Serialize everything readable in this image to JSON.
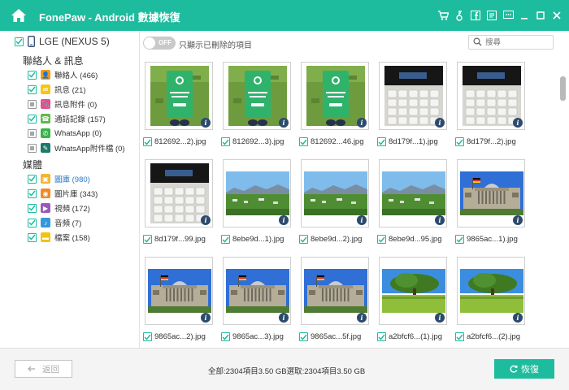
{
  "app": {
    "title": "FonePaw - Android 數據恢復",
    "accent_color": "#1ebc9e",
    "titlebar_icons": [
      "cart-icon",
      "key-icon",
      "facebook-icon",
      "feedback-icon",
      "chat-icon",
      "minimize-icon",
      "maximize-icon",
      "close-icon"
    ]
  },
  "sidebar": {
    "device": "LGE (NEXUS 5)",
    "categories": [
      {
        "title": "聯絡人 & 訊息",
        "items": [
          {
            "label": "聯絡人 (466)",
            "icon": "contacts-icon",
            "color": "#f39a1e",
            "checked": "partial"
          },
          {
            "label": "訊息 (21)",
            "icon": "message-icon",
            "color": "#f5c518",
            "checked": "partial"
          },
          {
            "label": "訊息附件 (0)",
            "icon": "attachment-icon",
            "color": "#e94d8a",
            "checked": "gray"
          },
          {
            "label": "通話記錄 (157)",
            "icon": "call-log-icon",
            "color": "#5fb94b",
            "checked": "partial"
          },
          {
            "label": "WhatsApp (0)",
            "icon": "whatsapp-icon",
            "color": "#3bb34a",
            "checked": "gray"
          },
          {
            "label": "WhatsApp附件檔 (0)",
            "icon": "whatsapp-attachment-icon",
            "color": "#1d7a6b",
            "checked": "gray"
          }
        ]
      },
      {
        "title": "媒體",
        "items": [
          {
            "label": "圖庫 (980)",
            "icon": "gallery-icon",
            "color": "#f2b531",
            "checked": "checked",
            "active": true
          },
          {
            "label": "圖片庫 (343)",
            "icon": "picture-library-icon",
            "color": "#f08a24",
            "checked": "checked"
          },
          {
            "label": "視頻 (172)",
            "icon": "video-icon",
            "color": "#9b59b6",
            "checked": "checked"
          },
          {
            "label": "音頻 (7)",
            "icon": "audio-icon",
            "color": "#3498db",
            "checked": "checked"
          },
          {
            "label": "檔案 (158)",
            "icon": "folder-icon",
            "color": "#f1c40f",
            "checked": "checked"
          }
        ]
      }
    ]
  },
  "filter": {
    "toggle_state": "OFF",
    "label": "只顯示已刪除的項目",
    "search_placeholder": "搜尋"
  },
  "grid": {
    "rows": [
      [
        {
          "name": "812692...2).jpg",
          "kind": "whatsapp"
        },
        {
          "name": "812692...3).jpg",
          "kind": "whatsapp"
        },
        {
          "name": "812692...46.jpg",
          "kind": "whatsapp"
        },
        {
          "name": "8d179f...1).jpg",
          "kind": "keyboard"
        },
        {
          "name": "8d179f...2).jpg",
          "kind": "keyboard"
        }
      ],
      [
        {
          "name": "8d179f...99.jpg",
          "kind": "keyboard"
        },
        {
          "name": "8ebe9d...1).jpg",
          "kind": "landscape"
        },
        {
          "name": "8ebe9d...2).jpg",
          "kind": "landscape"
        },
        {
          "name": "8ebe9d...95.jpg",
          "kind": "landscape"
        },
        {
          "name": "9865ac...1).jpg",
          "kind": "reichstag"
        }
      ],
      [
        {
          "name": "9865ac...2).jpg",
          "kind": "reichstag"
        },
        {
          "name": "9865ac...3).jpg",
          "kind": "reichstag"
        },
        {
          "name": "9865ac...5f.jpg",
          "kind": "reichstag"
        },
        {
          "name": "a2bfcf6...(1).jpg",
          "kind": "tree"
        },
        {
          "name": "a2bfcf6...(2).jpg",
          "kind": "tree"
        }
      ]
    ]
  },
  "footer": {
    "back_label": "返回",
    "summary": "全部:2304項目3.50 GB選取:2304項目3.50 GB",
    "recover_label": "恢復"
  }
}
